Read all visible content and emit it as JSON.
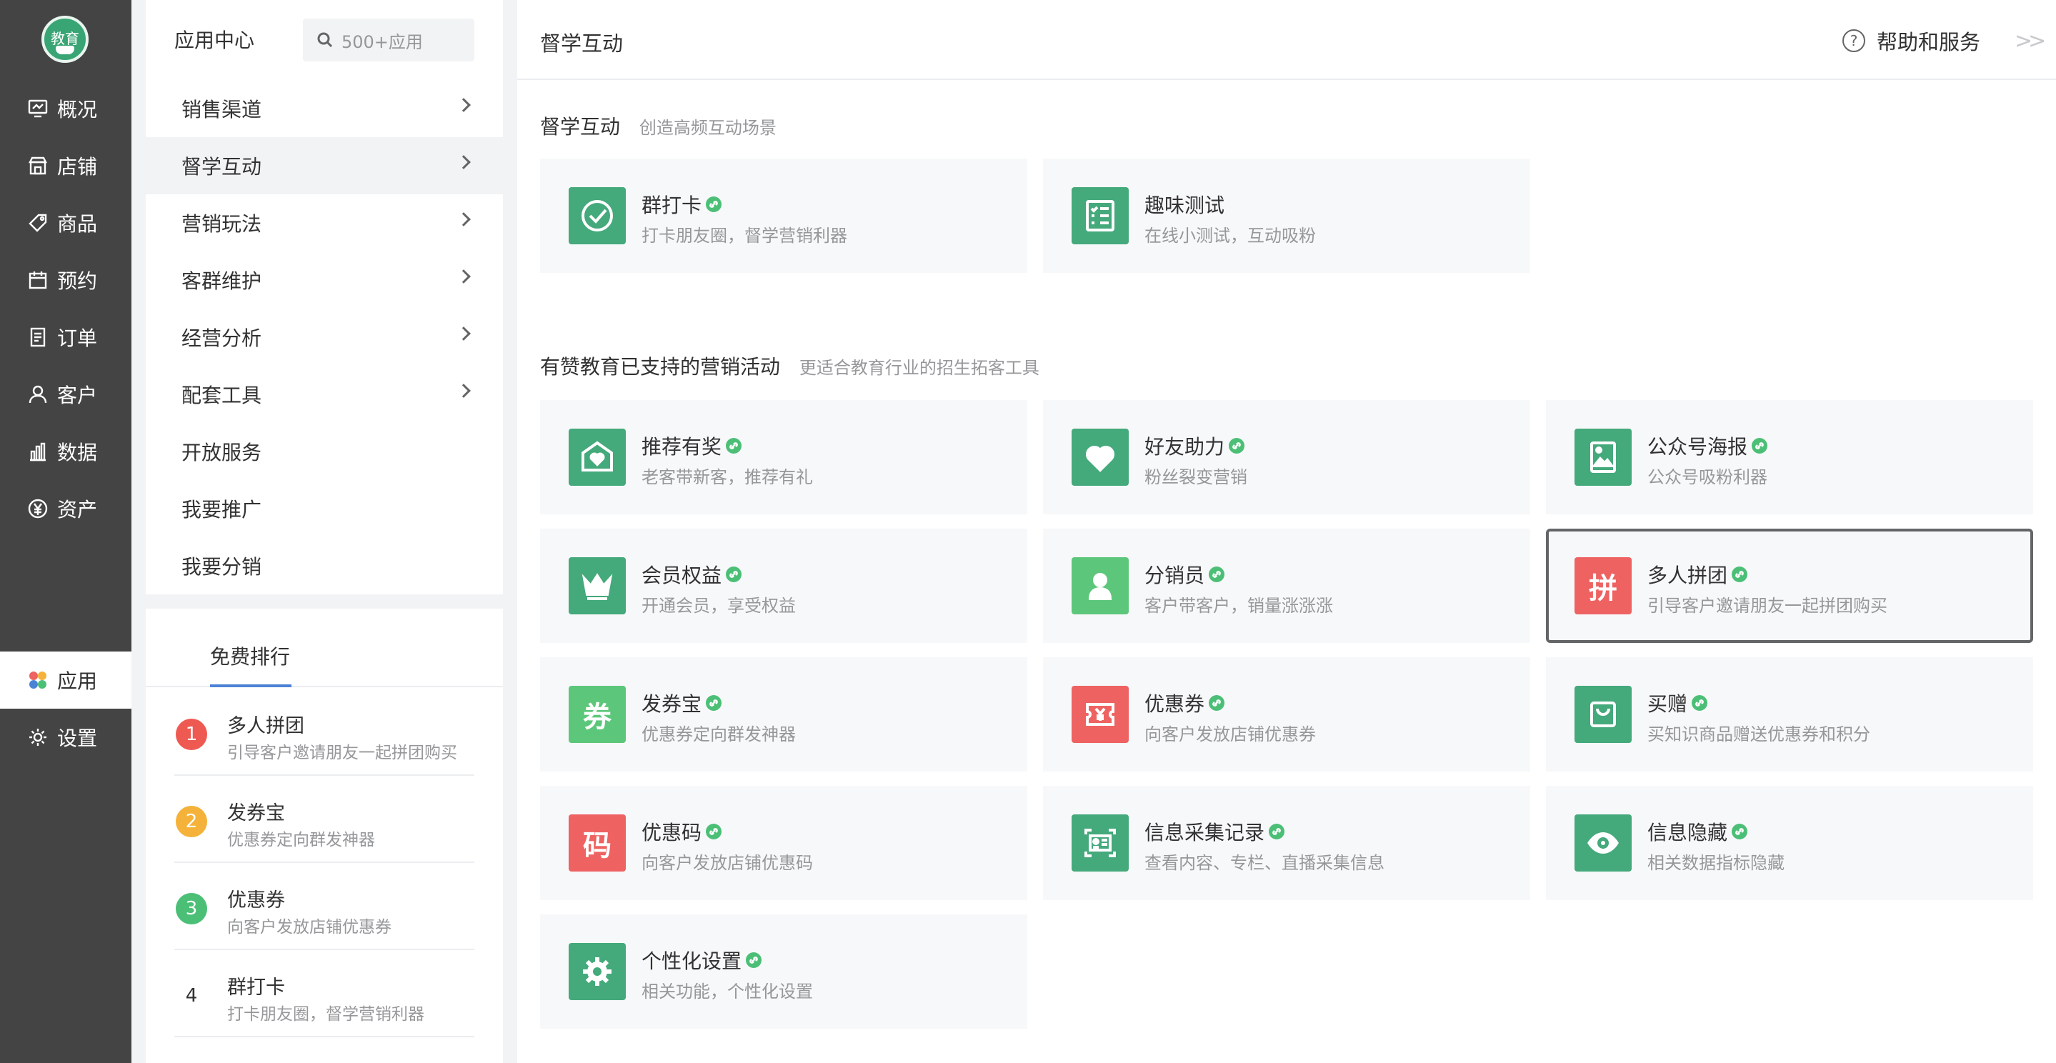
{
  "nav": {
    "logo_text": "教育",
    "items": [
      {
        "label": "概况"
      },
      {
        "label": "店铺"
      },
      {
        "label": "商品"
      },
      {
        "label": "预约"
      },
      {
        "label": "订单"
      },
      {
        "label": "客户"
      },
      {
        "label": "数据"
      },
      {
        "label": "资产"
      },
      {
        "label": "应用"
      },
      {
        "label": "设置"
      }
    ],
    "active": "应用"
  },
  "submenu": {
    "title": "应用中心",
    "search_placeholder": "500+应用",
    "items": [
      {
        "label": "销售渠道"
      },
      {
        "label": "督学互动"
      },
      {
        "label": "营销玩法"
      },
      {
        "label": "客群维护"
      },
      {
        "label": "经营分析"
      },
      {
        "label": "配套工具"
      },
      {
        "label": "开放服务"
      },
      {
        "label": "我要推广"
      },
      {
        "label": "我要分销"
      }
    ],
    "active": "督学互动"
  },
  "ranking": {
    "tab": "免费排行",
    "items": [
      {
        "rank": "1",
        "name": "多人拼团",
        "desc": "引导客户邀请朋友一起拼团购买",
        "color": "#ee5a52"
      },
      {
        "rank": "2",
        "name": "发券宝",
        "desc": "优惠券定向群发神器",
        "color": "#f5b23a"
      },
      {
        "rank": "3",
        "name": "优惠券",
        "desc": "向客户发放店铺优惠券",
        "color": "#4cbf77"
      },
      {
        "rank": "4",
        "name": "群打卡",
        "desc": "打卡朋友圈，督学营销利器",
        "color": ""
      }
    ]
  },
  "header": {
    "title": "督学互动",
    "help_label": "帮助和服务",
    "help_icon": "?",
    "collapse_icon": ">>"
  },
  "section1": {
    "title": "督学互动",
    "subtitle": "创造高频互动场景",
    "cards": [
      {
        "name": "群打卡",
        "desc": "打卡朋友圈，督学营销利器",
        "icon": "check-circle-icon",
        "color": "#44a97b"
      },
      {
        "name": "趣味测试",
        "desc": "在线小测试，互动吸粉",
        "icon": "checklist-icon",
        "color": "#44a97b"
      }
    ]
  },
  "section2": {
    "title": "有赞教育已支持的营销活动",
    "subtitle": "更适合教育行业的招生拓客工具",
    "cards": [
      {
        "name": "推荐有奖",
        "desc": "老客带新客，推荐有礼",
        "icon": "heart-envelope-icon",
        "color": "#44a97b"
      },
      {
        "name": "好友助力",
        "desc": "粉丝裂变营销",
        "icon": "heart-icon",
        "color": "#44a97b"
      },
      {
        "name": "公众号海报",
        "desc": "公众号吸粉利器",
        "icon": "poster-icon",
        "color": "#44a97b"
      },
      {
        "name": "会员权益",
        "desc": "开通会员，享受权益",
        "icon": "crown-icon",
        "color": "#44a97b"
      },
      {
        "name": "分销员",
        "desc": "客户带客户，销量涨涨涨",
        "icon": "person-icon",
        "color": "#5cc77a"
      },
      {
        "name": "多人拼团",
        "desc": "引导客户邀请朋友一起拼团购买",
        "icon": "pin-char-icon",
        "glyph": "拼",
        "color": "#ee6262"
      },
      {
        "name": "发券宝",
        "desc": "优惠券定向群发神器",
        "icon": "coupon-char-icon",
        "glyph": "券",
        "color": "#5cc77a"
      },
      {
        "name": "优惠券",
        "desc": "向客户发放店铺优惠券",
        "icon": "yen-ticket-icon",
        "color": "#ee6262"
      },
      {
        "name": "买赠",
        "desc": "买知识商品赠送优惠券和积分",
        "icon": "shopping-bag-icon",
        "color": "#44a97b"
      },
      {
        "name": "优惠码",
        "desc": "向客户发放店铺优惠码",
        "icon": "code-char-icon",
        "glyph": "码",
        "color": "#ee6262"
      },
      {
        "name": "信息采集记录",
        "desc": "查看内容、专栏、直播采集信息",
        "icon": "id-card-icon",
        "color": "#44a97b"
      },
      {
        "name": "信息隐藏",
        "desc": "相关数据指标隐藏",
        "icon": "eye-icon",
        "color": "#44a97b"
      },
      {
        "name": "个性化设置",
        "desc": "相关功能，个性化设置",
        "icon": "gear-icon",
        "color": "#44a97b"
      }
    ],
    "selected": "多人拼团"
  }
}
